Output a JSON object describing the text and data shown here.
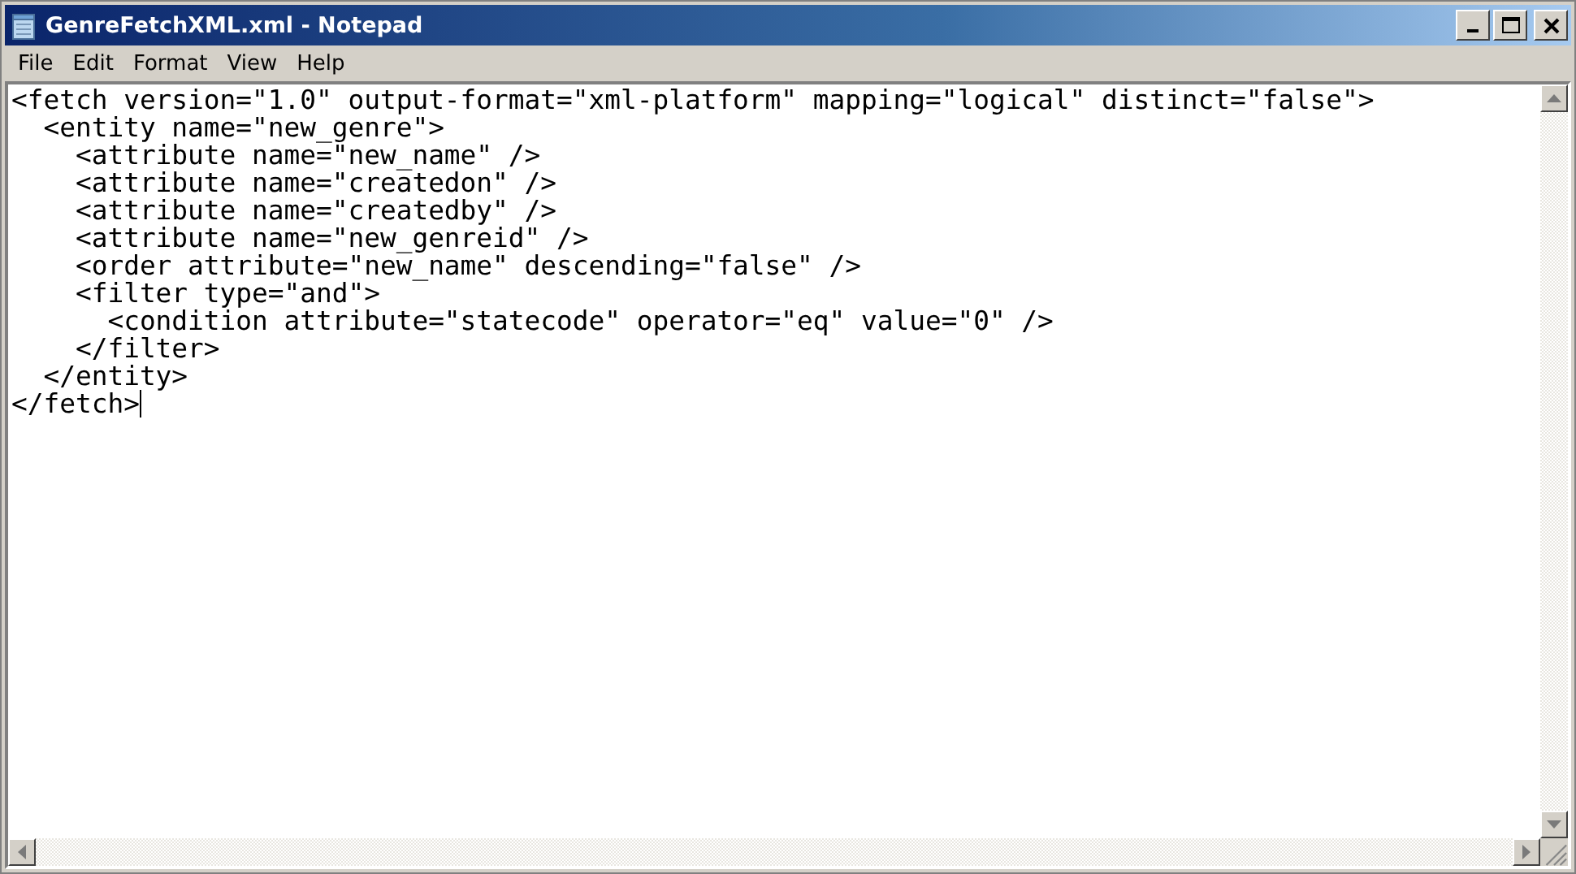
{
  "window": {
    "title": "GenreFetchXML.xml - Notepad"
  },
  "menu": [
    "File",
    "Edit",
    "Format",
    "View",
    "Help"
  ],
  "editor": {
    "lines": [
      "<fetch version=\"1.0\" output-format=\"xml-platform\" mapping=\"logical\" distinct=\"false\">",
      "  <entity name=\"new_genre\">",
      "    <attribute name=\"new_name\" />",
      "    <attribute name=\"createdon\" />",
      "    <attribute name=\"createdby\" />",
      "    <attribute name=\"new_genreid\" />",
      "    <order attribute=\"new_name\" descending=\"false\" />",
      "    <filter type=\"and\">",
      "      <condition attribute=\"statecode\" operator=\"eq\" value=\"0\" />",
      "    </filter>",
      "  </entity>",
      "</fetch>"
    ]
  }
}
